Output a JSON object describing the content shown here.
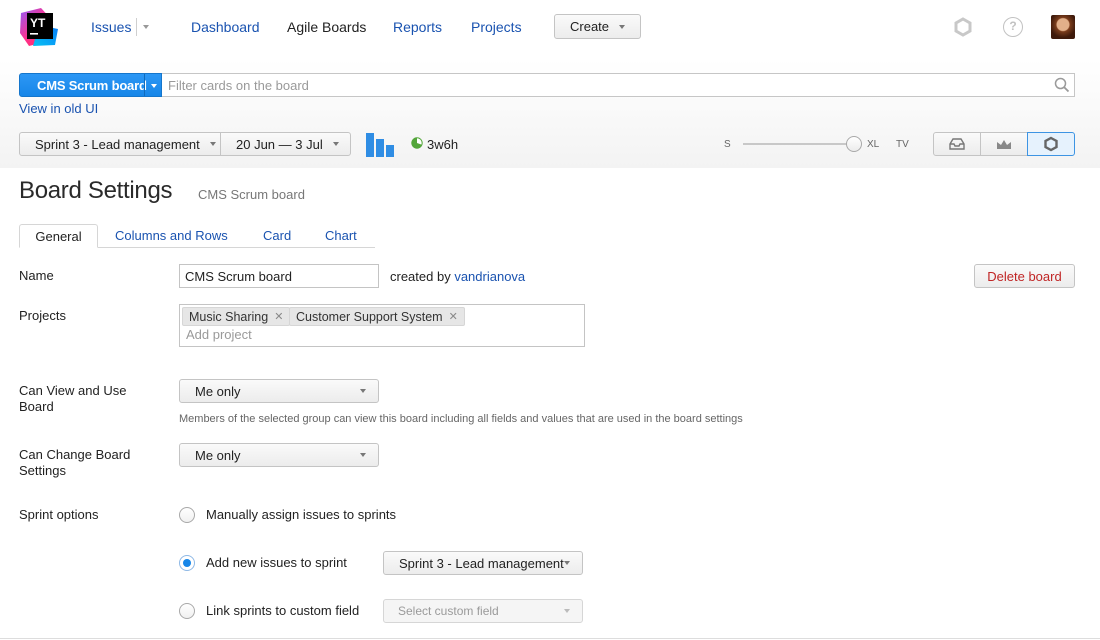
{
  "header": {
    "logo_text": "YT",
    "nav": {
      "issues": "Issues",
      "dashboard": "Dashboard",
      "agile_boards": "Agile Boards",
      "reports": "Reports",
      "projects": "Projects"
    },
    "create_label": "Create",
    "help_glyph": "?",
    "icons": [
      "settings-icon",
      "help-icon",
      "avatar"
    ]
  },
  "board": {
    "name": "CMS Scrum board",
    "filter_placeholder": "Filter cards on the board",
    "old_ui_link": "View in old UI",
    "sprint": "Sprint 3 - Lead management",
    "dates": "20 Jun — 3 Jul",
    "estimate": "3w6h",
    "size_min": "S",
    "size_max": "XL",
    "tv": "TV"
  },
  "settings": {
    "title": "Board Settings",
    "subtitle": "CMS Scrum board",
    "tabs": [
      "General",
      "Columns and Rows",
      "Card",
      "Chart"
    ],
    "name_label": "Name",
    "name_value": "CMS Scrum board",
    "created_by_prefix": "created by",
    "created_by_user": "vandrianova",
    "delete_label": "Delete board",
    "projects_label": "Projects",
    "projects": [
      "Music Sharing",
      "Customer Support System"
    ],
    "add_project_placeholder": "Add project",
    "can_view_label": "Can View and Use Board",
    "can_view_value": "Me only",
    "can_view_hint": "Members of the selected group can view this board including all fields and values that are used in the board settings",
    "can_change_label": "Can Change Board Settings",
    "can_change_value": "Me only",
    "sprint_options_label": "Sprint options",
    "sprint_options": [
      {
        "label": "Manually assign issues to sprints",
        "checked": false
      },
      {
        "label": "Add new issues to sprint",
        "checked": true
      },
      {
        "label": "Link sprints to custom field",
        "checked": false
      }
    ],
    "sprint_select_value": "Sprint 3 - Lead management",
    "custom_field_placeholder": "Select custom field"
  },
  "colors": {
    "accent_blue": "#1786e8",
    "link_blue": "#1a53b0",
    "danger_red": "#c02525"
  }
}
